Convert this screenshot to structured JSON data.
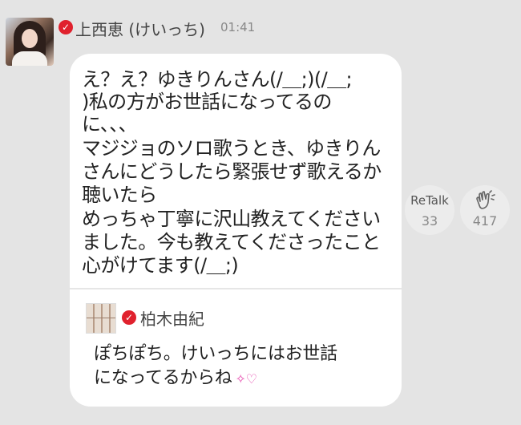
{
  "post": {
    "sender_name": "上西恵 (けいっち)",
    "timestamp": "01:41",
    "message_lines": [
      "え？え？ゆきりんさん(/＿;)(/＿;",
      ")私の方がお世話になってるの",
      "に、、、",
      "マジジョのソロ歌うとき、ゆきりん",
      "さんにどうしたら緊張せず歌えるか",
      "聴いたら",
      "めっちゃ丁寧に沢山教えてください",
      "ました。今も教えてくださったこと",
      "心がけてます(/＿;)"
    ]
  },
  "quoted": {
    "name": "柏木由紀",
    "lines": [
      "ぽちぽち。けいっちにはお世話",
      "になってるからね"
    ]
  },
  "actions": {
    "retalk_label": "ReTalk",
    "retalk_count": "33",
    "like_count": "417"
  },
  "colors": {
    "background": "#e4e4e4",
    "bubble": "#ffffff",
    "verified": "#e0212d"
  },
  "icons": [
    "verified-check-icon",
    "clap-hands-icon",
    "sparkle-heart-emoji-icon"
  ]
}
